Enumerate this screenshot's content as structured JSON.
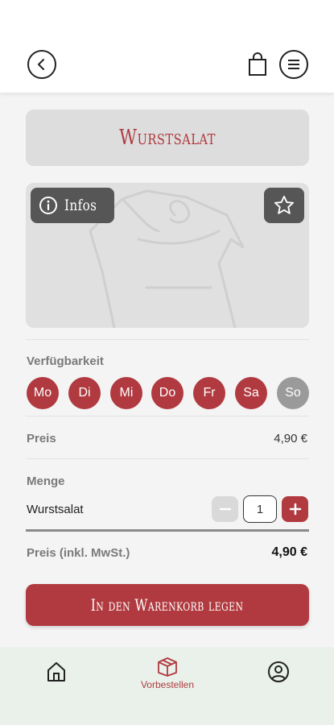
{
  "header": {
    "back_icon": "chevron-left-icon",
    "bag_icon": "shopping-bag-icon",
    "menu_icon": "hamburger-menu-icon"
  },
  "product": {
    "title": "Wurstsalat",
    "infos_label": "Infos",
    "favorite_icon": "star-icon"
  },
  "availability": {
    "label": "Verfügbarkeit",
    "days": [
      {
        "label": "Mo",
        "available": true
      },
      {
        "label": "Di",
        "available": true
      },
      {
        "label": "Mi",
        "available": true
      },
      {
        "label": "Do",
        "available": true
      },
      {
        "label": "Fr",
        "available": true
      },
      {
        "label": "Sa",
        "available": true
      },
      {
        "label": "So",
        "available": false
      }
    ]
  },
  "price": {
    "label": "Preis",
    "value": "4,90 €"
  },
  "quantity": {
    "label": "Menge",
    "item_name": "Wurstsalat",
    "value": "1"
  },
  "total": {
    "label": "Preis (inkl. MwSt.)",
    "value": "4,90 €"
  },
  "cart_button": {
    "label": "In den Warenkorb legen"
  },
  "bottom_nav": {
    "items": [
      {
        "icon": "home-icon",
        "label": ""
      },
      {
        "icon": "preorder-box-icon",
        "label": "Vorbestellen"
      },
      {
        "icon": "profile-icon",
        "label": ""
      }
    ]
  },
  "colors": {
    "accent": "#b03a3f",
    "inactive_day": "#9a9a9a",
    "nav_background": "#e9f1ea"
  }
}
